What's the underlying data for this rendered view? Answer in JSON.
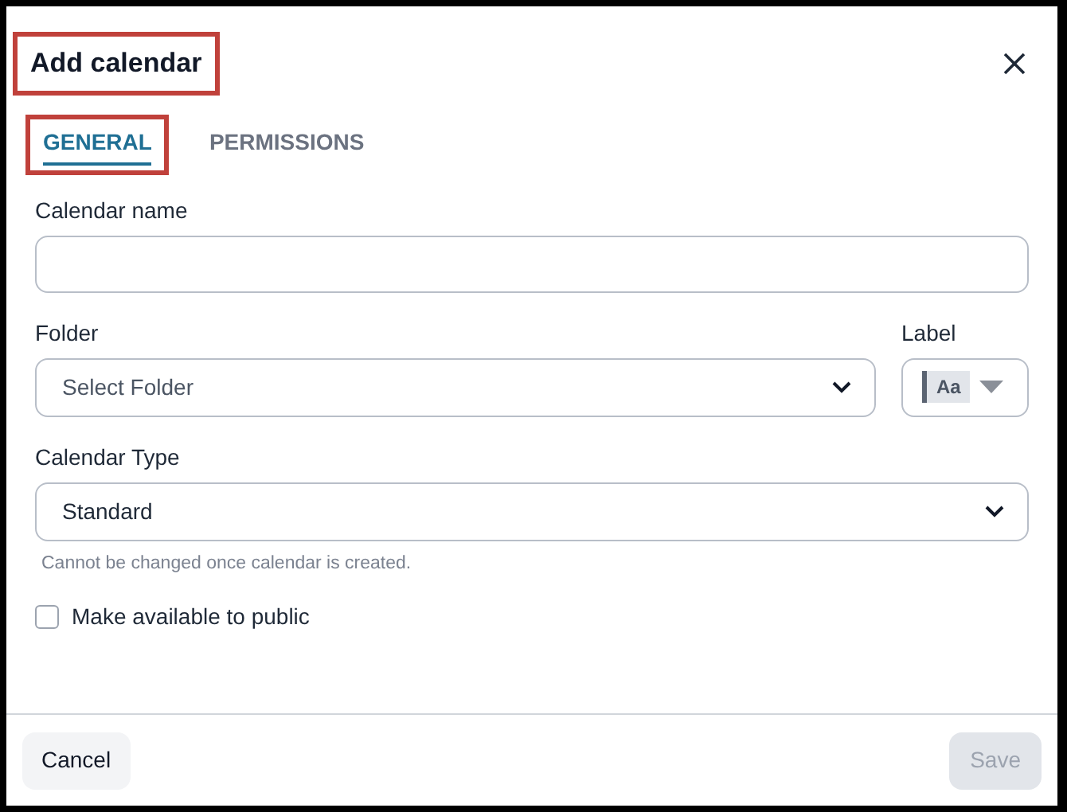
{
  "dialog": {
    "title": "Add calendar",
    "title_highlighted": true
  },
  "tabs": [
    {
      "label": "GENERAL",
      "selected": true,
      "highlighted": true
    },
    {
      "label": "PERMISSIONS",
      "selected": false,
      "highlighted": false
    }
  ],
  "fields": [
    {
      "kind": "text",
      "label": "Calendar name"
    },
    {
      "kind": "select",
      "label": "Folder",
      "placeholder": "Select Folder",
      "label_picker": {
        "label": "Label",
        "swatch": "Aa"
      }
    },
    {
      "kind": "select",
      "label": "Calendar Type",
      "value": "Standard",
      "hint": "Cannot be changed once calendar is created."
    },
    {
      "kind": "checkbox",
      "label": "Make available to public",
      "checked": false
    }
  ],
  "footer": {
    "cancel": {
      "label": "Cancel",
      "disabled": false
    },
    "save": {
      "label": "Save",
      "disabled": true
    }
  }
}
